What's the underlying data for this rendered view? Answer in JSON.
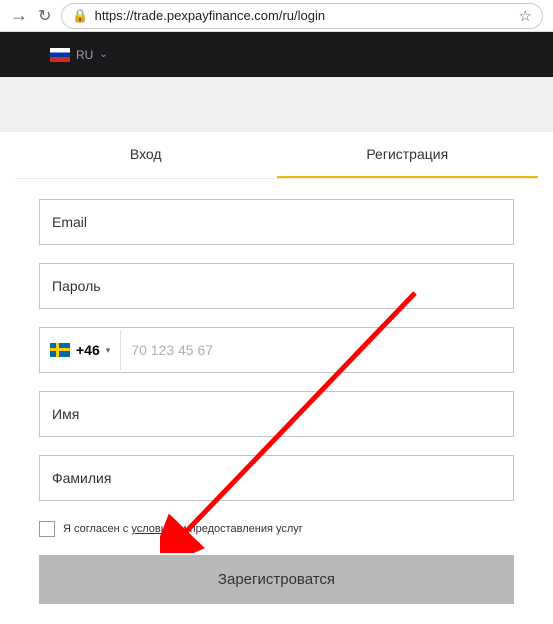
{
  "browser": {
    "url": "https://trade.pexpayfinance.com/ru/login"
  },
  "header": {
    "lang_label": "RU"
  },
  "tabs": {
    "login": "Вход",
    "register": "Регистрация"
  },
  "form": {
    "email_placeholder": "Email",
    "password_placeholder": "Пароль",
    "dial_code": "+46",
    "phone_placeholder": "70 123 45 67",
    "firstname_placeholder": "Имя",
    "lastname_placeholder": "Фамилия",
    "terms_prefix": "Я согласен с ",
    "terms_link": "условиями",
    "terms_suffix": " предоставления услуг",
    "submit_label": "Зарегистроватся"
  }
}
